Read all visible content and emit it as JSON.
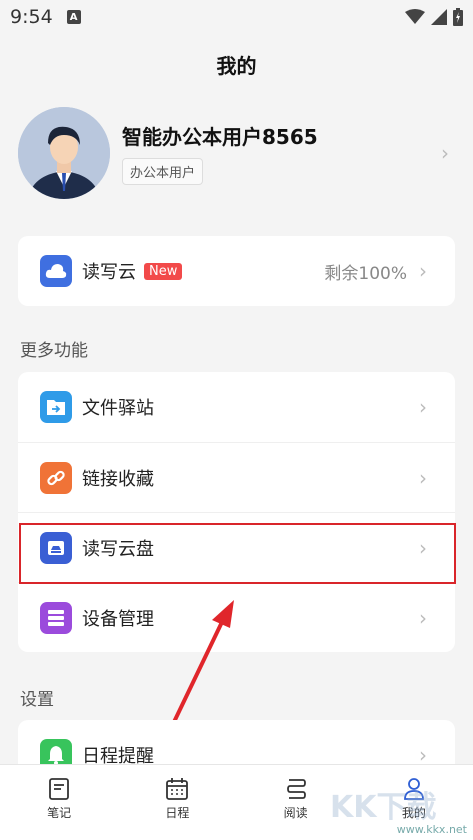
{
  "status": {
    "time": "9:54",
    "a_icon": "A"
  },
  "page": {
    "title": "我的"
  },
  "profile": {
    "username": "智能办公本用户8565",
    "role": "办公本用户"
  },
  "cloud": {
    "label": "读写云",
    "badge": "New",
    "remaining": "剩余100%",
    "icon": "cloud-icon",
    "color": "#3f6fe0"
  },
  "more": {
    "heading": "更多功能",
    "items": [
      {
        "label": "文件驿站",
        "icon": "file-transfer-icon",
        "color": "#2f9be8"
      },
      {
        "label": "链接收藏",
        "icon": "link-icon",
        "color": "#f07337"
      },
      {
        "label": "读写云盘",
        "icon": "cloud-drive-icon",
        "color": "#3a5fd4"
      },
      {
        "label": "设备管理",
        "icon": "device-list-icon",
        "color": "#9b4bdc"
      }
    ]
  },
  "settings": {
    "heading": "设置",
    "items": [
      {
        "label": "日程提醒",
        "icon": "bell-icon",
        "color": "#38c45c"
      }
    ]
  },
  "tabs": [
    {
      "label": "笔记",
      "icon": "note-icon"
    },
    {
      "label": "日程",
      "icon": "calendar-icon"
    },
    {
      "label": "阅读",
      "icon": "read-icon"
    },
    {
      "label": "我的",
      "icon": "person-icon",
      "active": true
    }
  ],
  "accent": "#d9252a",
  "watermark": {
    "big": "KK下载",
    "url": "www.kkx.net"
  }
}
